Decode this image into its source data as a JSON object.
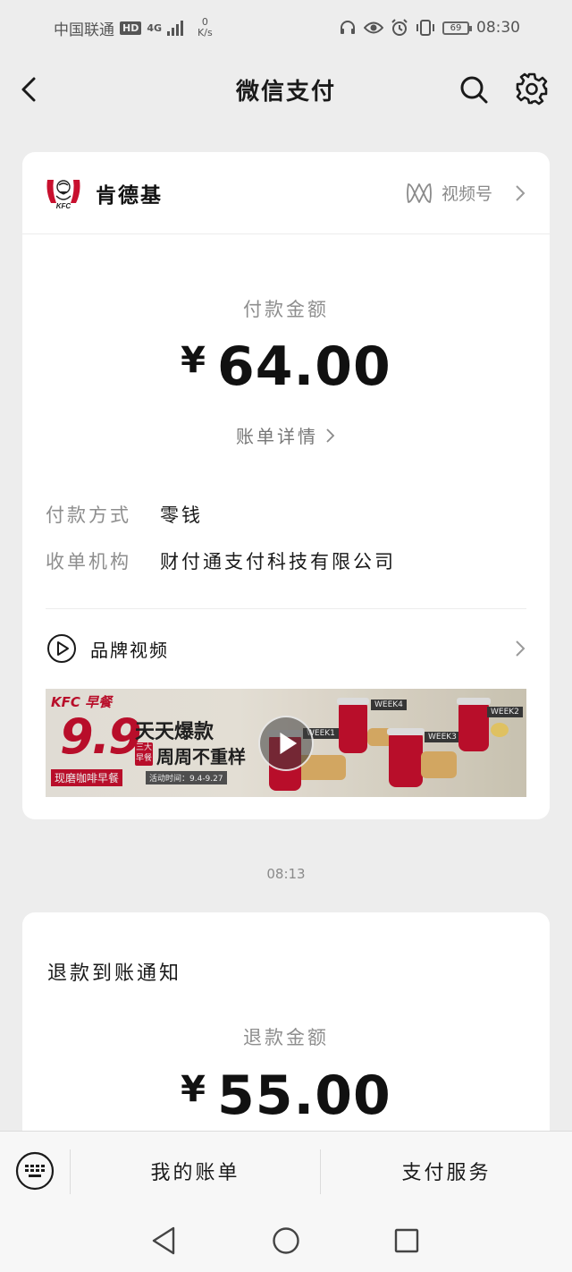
{
  "status_bar": {
    "carrier": "中国联通",
    "hd": "HD",
    "network": "4G",
    "speed_value": "0",
    "speed_unit": "K/s",
    "battery": "69",
    "time": "08:30"
  },
  "nav": {
    "title": "微信支付"
  },
  "payment_card": {
    "merchant": "肯德基",
    "logo_text": "KFC",
    "channels_label": "视频号",
    "amount_label": "付款金额",
    "currency": "¥",
    "amount": "64.00",
    "bill_detail": "账单详情",
    "rows": [
      {
        "key": "付款方式",
        "value": "零钱"
      },
      {
        "key": "收单机构",
        "value": "财付通支付科技有限公司"
      }
    ],
    "brand_video_label": "品牌视频",
    "banner": {
      "brand": "KFC 早餐",
      "price": "9.9",
      "subtitle": "现磨咖啡早餐",
      "date": "活动时间：9.4-9.27",
      "line1": "天天爆款",
      "line2": "周周不重样",
      "tag": "三大早餐",
      "weeks": [
        "WEEK1",
        "WEEK2",
        "WEEK3",
        "WEEK4"
      ]
    }
  },
  "timestamp": "08:13",
  "refund_card": {
    "title": "退款到账通知",
    "amount_label": "退款金额",
    "currency": "¥",
    "amount": "55.00"
  },
  "bottom_bar": {
    "item1": "我的账单",
    "item2": "支付服务"
  },
  "colors": {
    "background": "#ededed",
    "kfc_red": "#c8102e",
    "secondary_text": "#8e8e8e"
  }
}
